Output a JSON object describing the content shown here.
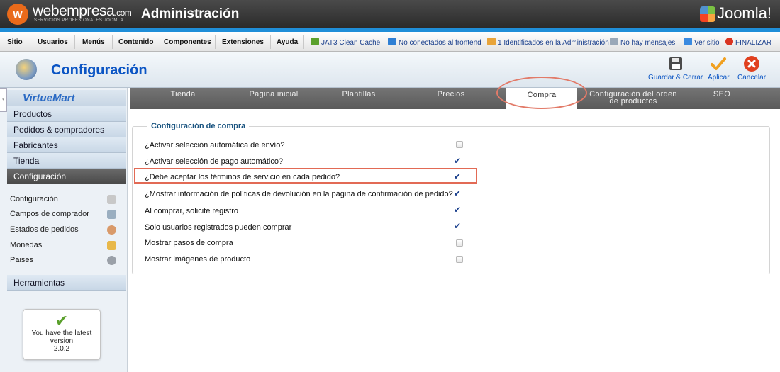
{
  "brand": {
    "name": "webempresa",
    "domain": ".com",
    "tagline": "SERVICIOS PROFESIONALES JOOMLA",
    "logo_letter": "w"
  },
  "header": {
    "title": "Administración",
    "joomla": "Joomla!"
  },
  "menu": {
    "items": [
      "Sitio",
      "Usuarios",
      "Menús",
      "Contenido",
      "Componentes",
      "Extensiones",
      "Ayuda"
    ],
    "status": [
      {
        "label": "JAT3 Clean Cache",
        "icon": "broom-icon",
        "color": "#5aa02c"
      },
      {
        "label": "No conectados al frontend",
        "icon": "users-icon",
        "color": "#2f7fd4"
      },
      {
        "label": "1 Identificados en la Administración",
        "icon": "user-icon",
        "color": "#e8a43a"
      },
      {
        "label": "No hay mensajes",
        "icon": "message-icon",
        "color": "#9aa8b8"
      },
      {
        "label": "Ver sitio",
        "icon": "monitor-icon",
        "color": "#3a8ae0"
      },
      {
        "label": "FINALIZAR",
        "icon": "power-icon",
        "color": "#d9331f"
      }
    ]
  },
  "toolbar": {
    "title": "Configuración",
    "save_close": "Guardar & Cerrar",
    "apply": "Aplicar",
    "cancel": "Cancelar"
  },
  "sidebar": {
    "logo": "VirtueMart",
    "nav": [
      "Productos",
      "Pedidos & compradores",
      "Fabricantes",
      "Tienda",
      "Configuración"
    ],
    "active_nav": "Configuración",
    "subitems": [
      {
        "label": "Configuración",
        "icon": "tools-icon",
        "color": "#c8c8c8"
      },
      {
        "label": "Campos de comprador",
        "icon": "form-icon",
        "color": "#9aaec0"
      },
      {
        "label": "Estados de pedidos",
        "icon": "status-icon",
        "color": "#d99a6a"
      },
      {
        "label": "Monedas",
        "icon": "coins-icon",
        "color": "#e8b84a"
      },
      {
        "label": "Paises",
        "icon": "globe-icon",
        "color": "#9aa0a8"
      }
    ],
    "tools": "Herramientas",
    "version": {
      "line1": "You have the latest",
      "line2": "version",
      "number": "2.0.2"
    }
  },
  "tabs": [
    {
      "label": "Tienda",
      "active": false
    },
    {
      "label": "Pagina inicial",
      "active": false
    },
    {
      "label": "Plantillas",
      "active": false
    },
    {
      "label": "Precios",
      "active": false
    },
    {
      "label": "Compra",
      "active": true
    },
    {
      "label": "Configuración del orden de productos",
      "active": false
    },
    {
      "label": "SEO",
      "active": false
    }
  ],
  "section": {
    "legend": "Configuración de compra",
    "options": [
      {
        "label": "¿Activar selección automática de envío?",
        "checked": false
      },
      {
        "label": "¿Activar selección de pago automático?",
        "checked": true
      },
      {
        "label": "¿Debe aceptar los términos de servicio en cada pedido?",
        "checked": true,
        "highlighted": true
      },
      {
        "label": "¿Mostrar información de políticas de devolución en la página de confirmación de pedido?",
        "checked": true
      },
      {
        "label": "Al comprar, solicite registro",
        "checked": true
      },
      {
        "label": "Solo usuarios registrados pueden comprar",
        "checked": true
      },
      {
        "label": "Mostrar pasos de compra",
        "checked": false
      },
      {
        "label": "Mostrar imágenes de producto",
        "checked": false
      }
    ]
  }
}
